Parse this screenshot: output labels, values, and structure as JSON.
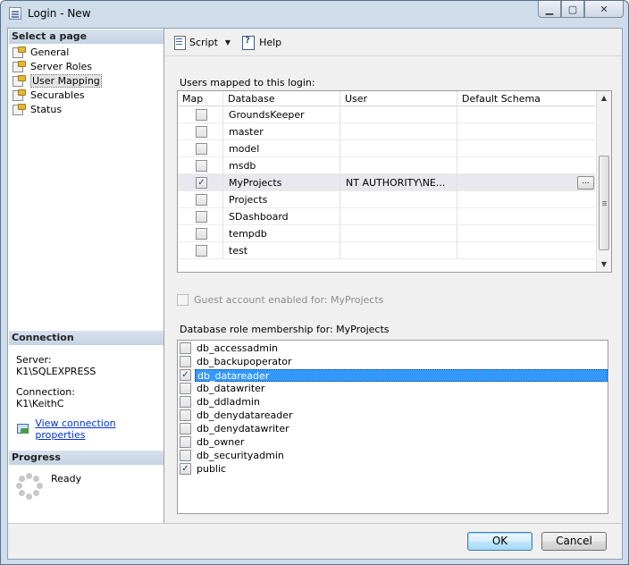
{
  "window": {
    "title": "Login - New"
  },
  "left": {
    "select_header": "Select a page",
    "pages": [
      "General",
      "Server Roles",
      "User Mapping",
      "Securables",
      "Status"
    ],
    "connection_header": "Connection",
    "server_label": "Server:",
    "server_value": "K1\\SQLEXPRESS",
    "connection_label": "Connection:",
    "connection_value": "K1\\KeithC",
    "view_link": "View connection properties",
    "progress_header": "Progress",
    "progress_status": "Ready"
  },
  "toolbar": {
    "script_label": "Script",
    "help_label": "Help"
  },
  "mapping": {
    "label": "Users mapped to this login:",
    "columns": [
      "Map",
      "Database",
      "User",
      "Default Schema"
    ],
    "rows": [
      {
        "map": false,
        "database": "GroundsKeeper",
        "user": "",
        "schema": ""
      },
      {
        "map": false,
        "database": "master",
        "user": "",
        "schema": ""
      },
      {
        "map": false,
        "database": "model",
        "user": "",
        "schema": ""
      },
      {
        "map": false,
        "database": "msdb",
        "user": "",
        "schema": ""
      },
      {
        "map": true,
        "database": "MyProjects",
        "user": "NT AUTHORITY\\NE...",
        "schema": ""
      },
      {
        "map": false,
        "database": "Projects",
        "user": "",
        "schema": ""
      },
      {
        "map": false,
        "database": "SDashboard",
        "user": "",
        "schema": ""
      },
      {
        "map": false,
        "database": "tempdb",
        "user": "",
        "schema": ""
      },
      {
        "map": false,
        "database": "test",
        "user": "",
        "schema": ""
      }
    ],
    "ellipsis": "..."
  },
  "guest": {
    "label": "Guest account enabled for: MyProjects",
    "checked": false
  },
  "roles": {
    "label": "Database role membership for: MyProjects",
    "items": [
      {
        "name": "db_accessadmin",
        "checked": false
      },
      {
        "name": "db_backupoperator",
        "checked": false
      },
      {
        "name": "db_datareader",
        "checked": true
      },
      {
        "name": "db_datawriter",
        "checked": false
      },
      {
        "name": "db_ddladmin",
        "checked": false
      },
      {
        "name": "db_denydatareader",
        "checked": false
      },
      {
        "name": "db_denydatawriter",
        "checked": false
      },
      {
        "name": "db_owner",
        "checked": false
      },
      {
        "name": "db_securityadmin",
        "checked": false
      },
      {
        "name": "public",
        "checked": true
      }
    ]
  },
  "footer": {
    "ok": "OK",
    "cancel": "Cancel"
  }
}
